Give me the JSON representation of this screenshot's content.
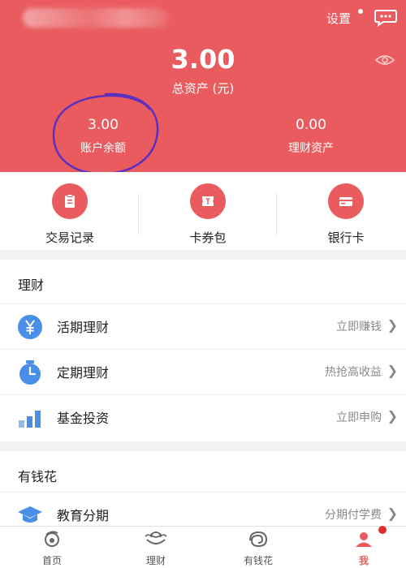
{
  "header": {
    "settings_label": "设置",
    "total_assets_value": "3.00",
    "total_assets_label": "总资产 (元)",
    "account_balance_value": "3.00",
    "account_balance_label": "账户余额",
    "wealth_assets_value": "0.00",
    "wealth_assets_label": "理财资产"
  },
  "quick_actions": [
    {
      "label": "交易记录",
      "icon": "clipboard-icon"
    },
    {
      "label": "卡券包",
      "icon": "ticket-icon"
    },
    {
      "label": "银行卡",
      "icon": "card-icon"
    }
  ],
  "wealth_section": {
    "title": "理财",
    "rows": [
      {
        "label": "活期理财",
        "right": "立即赚钱",
        "icon": "yen-coin-icon"
      },
      {
        "label": "定期理财",
        "right": "热抢高收益",
        "icon": "timer-icon"
      },
      {
        "label": "基金投资",
        "right": "立即申购",
        "icon": "bar-chart-icon"
      }
    ]
  },
  "spend_section": {
    "title": "有钱花",
    "rows": [
      {
        "label": "教育分期",
        "right": "分期付学费",
        "icon": "graduation-cap-icon"
      }
    ]
  },
  "bottom_nav": [
    {
      "label": "首页",
      "icon": "home-icon"
    },
    {
      "label": "理财",
      "icon": "wealth-icon"
    },
    {
      "label": "有钱花",
      "icon": "spend-icon"
    },
    {
      "label": "我",
      "icon": "me-icon"
    }
  ],
  "colors": {
    "brand": "#e95b5e",
    "icon_blue": "#4a8fe7",
    "annotation": "#5b2fbf"
  }
}
